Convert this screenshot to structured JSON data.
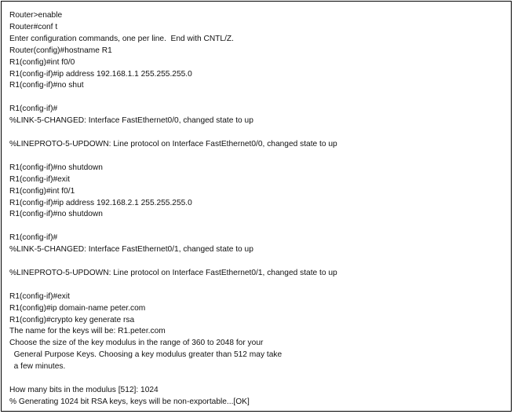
{
  "terminal": {
    "lines": [
      "Router>enable",
      "Router#conf t",
      "Enter configuration commands, one per line.  End with CNTL/Z.",
      "Router(config)#hostname R1",
      "R1(config)#int f0/0",
      "R1(config-if)#ip address 192.168.1.1 255.255.255.0",
      "R1(config-if)#no shut",
      "",
      "R1(config-if)#",
      "%LINK-5-CHANGED: Interface FastEthernet0/0, changed state to up",
      "",
      "%LINEPROTO-5-UPDOWN: Line protocol on Interface FastEthernet0/0, changed state to up",
      "",
      "R1(config-if)#no shutdown",
      "R1(config-if)#exit",
      "R1(config)#int f0/1",
      "R1(config-if)#ip address 192.168.2.1 255.255.255.0",
      "R1(config-if)#no shutdown",
      "",
      "R1(config-if)#",
      "%LINK-5-CHANGED: Interface FastEthernet0/1, changed state to up",
      "",
      "%LINEPROTO-5-UPDOWN: Line protocol on Interface FastEthernet0/1, changed state to up",
      "",
      "R1(config-if)#exit",
      "R1(config)#ip domain-name peter.com",
      "R1(config)#crypto key generate rsa",
      "The name for the keys will be: R1.peter.com",
      "Choose the size of the key modulus in the range of 360 to 2048 for your",
      "  General Purpose Keys. Choosing a key modulus greater than 512 may take",
      "  a few minutes.",
      "",
      "How many bits in the modulus [512]: 1024",
      "% Generating 1024 bit RSA keys, keys will be non-exportable...[OK]"
    ]
  }
}
